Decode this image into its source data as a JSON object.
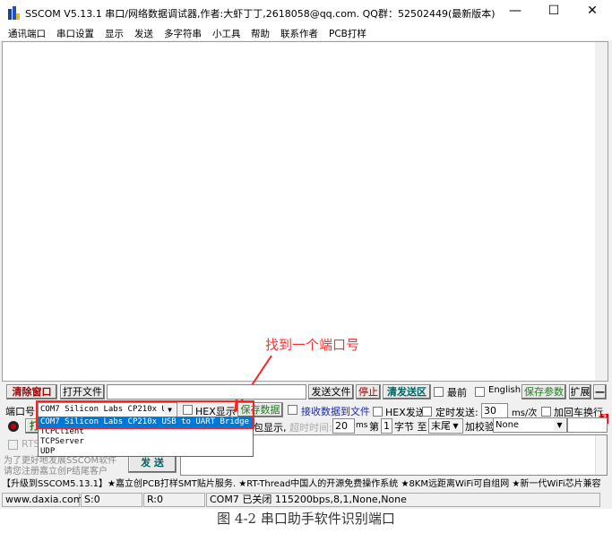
{
  "window": {
    "title": "SSCOM V5.13.1 串口/网络数据调试器,作者:大虾丁丁,2618058@qq.com. QQ群：52502449(最新版本)",
    "controls": {
      "minimize": "—",
      "maximize": "☐",
      "close": "✕"
    }
  },
  "menu": [
    "通讯端口",
    "串口设置",
    "显示",
    "发送",
    "多字符串",
    "小工具",
    "帮助",
    "联系作者",
    "PCB打样"
  ],
  "annotation": {
    "text": "找到一个端口号",
    "color": "#ff3030"
  },
  "toolbar1": {
    "clear_window": "清除窗口",
    "open_file": "打开文件",
    "file_path": "",
    "send_file": "发送文件",
    "stop": "停止",
    "clear_send": "清发送区",
    "topmost": "最前",
    "english": "English",
    "save_params": "保存参数",
    "expand": "扩展",
    "collapse": "—"
  },
  "toolbar2": {
    "port_label": "端口号",
    "port_value": "COM7 Silicon Labs CP210x U",
    "hex_display": "HEX显示",
    "save_data": "保存数据",
    "recv_to_file": "接收数据到文件",
    "hex_send": "HEX发送",
    "timed_send": "定时发送:",
    "interval": "30",
    "interval_unit": "ms/次",
    "add_crlf": "加回车换行",
    "help": "?"
  },
  "toolbar3": {
    "open_port": "打",
    "packet_display": "包显示,",
    "timeout_label": "超时时间:",
    "timeout": "20",
    "timeout_unit": "ms",
    "nth": "第",
    "byte_index": "1",
    "byte_to": "字节 至",
    "end_value": "末尾",
    "checksum_label": "加校验",
    "checksum_value": "None"
  },
  "toolbar4": {
    "rts": "RTS"
  },
  "port_dropdown": {
    "options": [
      "COM7 Silicon Labs CP210x USB to UART Bridge",
      "TCPClient",
      "TCPServer",
      "UDP"
    ],
    "selected": 0
  },
  "promo": {
    "line1": "为了更好地发展SSCOM软件",
    "line2": "请您注册嘉立创P结尾客户"
  },
  "send_button": "发 送",
  "send_text": "",
  "ticker": "【升级到SSCOM5.13.1】★嘉立创PCB打样SMT贴片服务. ★RT-Thread中国人的开源免费操作系统 ★8KM远距离WiFi可自组网 ★新一代WiFi芯片兼容",
  "statusbar": {
    "website": "www.daxia.com",
    "sent": "S:0",
    "received": "R:0",
    "port_status": "COM7 已关闭  115200bps,8,1,None,None"
  },
  "caption": "图 4-2 串口助手软件识别端口"
}
